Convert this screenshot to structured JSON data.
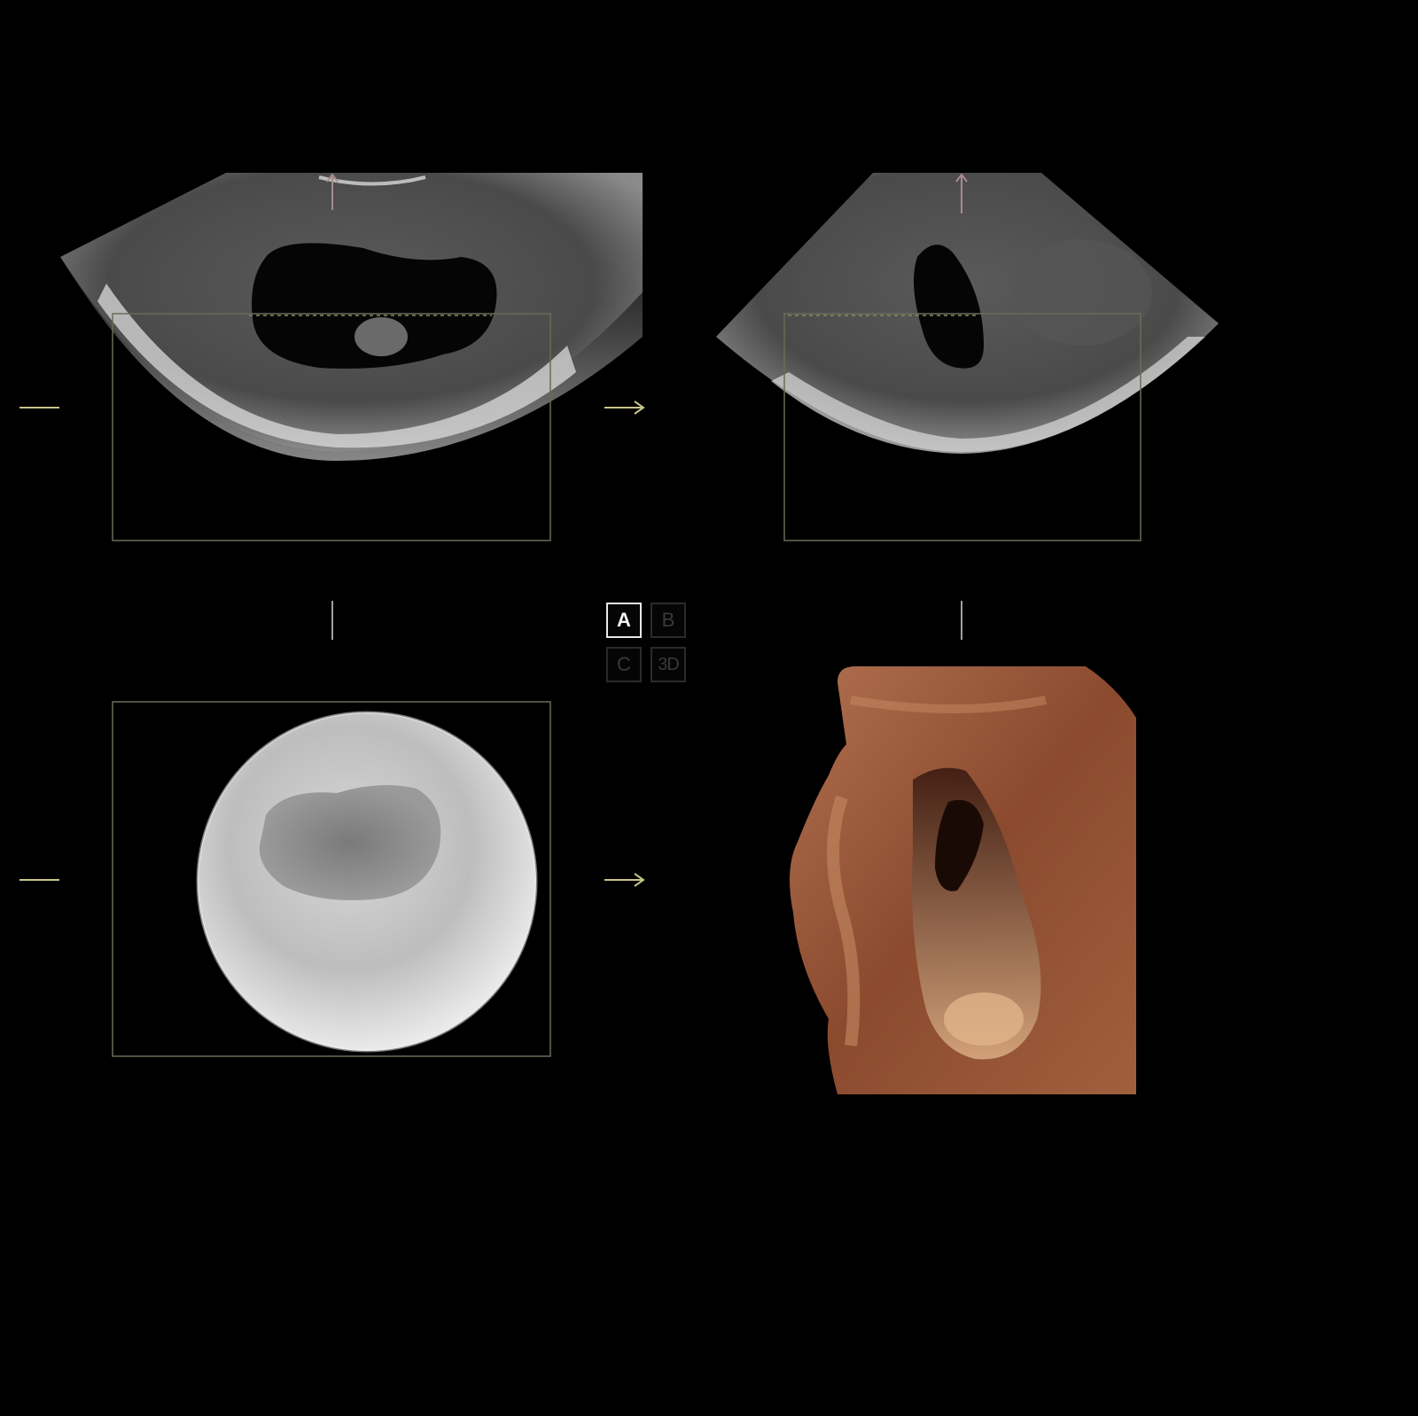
{
  "view_selector": {
    "buttons": [
      {
        "label": "A",
        "active": true
      },
      {
        "label": "B",
        "active": false
      },
      {
        "label": "C",
        "active": false
      },
      {
        "label": "3D",
        "active": false
      }
    ]
  },
  "colors": {
    "background": "#000000",
    "roi_box": "#6b6b5a",
    "axis_marker": "#c8c48a",
    "direction_arrow": "#a88b8e",
    "render_tissue": "#8b4a2e"
  },
  "icons": [
    "left-dash-marker",
    "right-arrow-marker",
    "top-arrow-marker",
    "vertical-tick-marker"
  ]
}
